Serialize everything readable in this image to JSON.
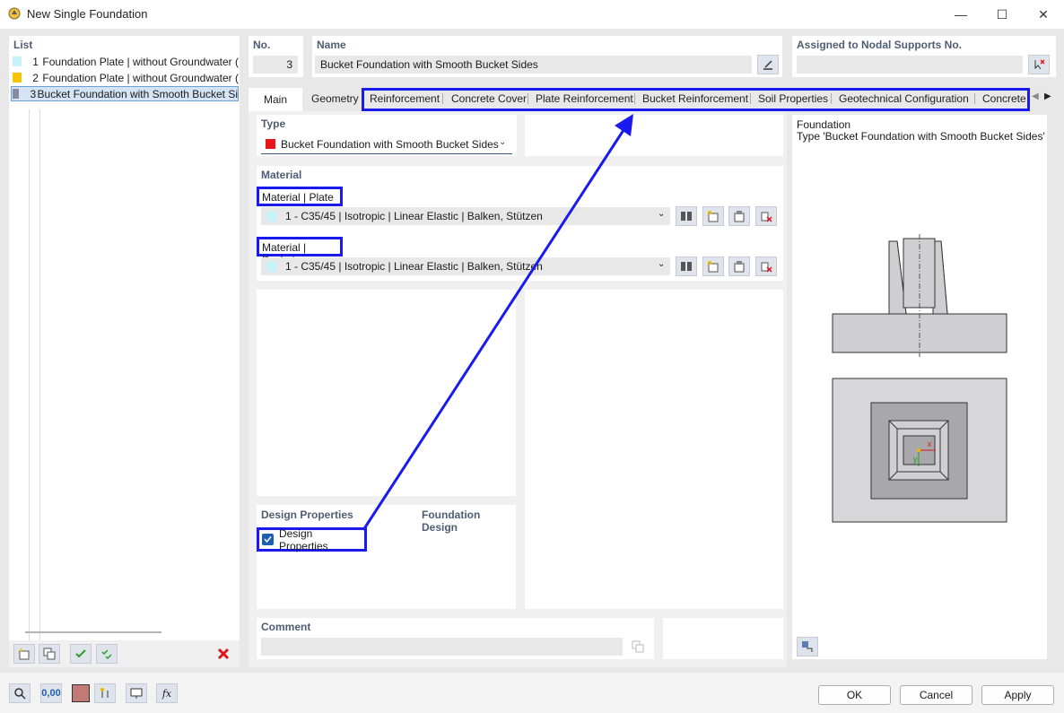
{
  "window": {
    "title": "New Single Foundation",
    "minimize": "—",
    "maximize": "☐",
    "close": "✕"
  },
  "list": {
    "header": "List",
    "items": [
      {
        "num": "1",
        "label": "Foundation Plate | without Groundwater (",
        "color": "#c5f3f9"
      },
      {
        "num": "2",
        "label": "Foundation Plate | without Groundwater (",
        "color": "#f7c400"
      },
      {
        "num": "3",
        "label": "Bucket Foundation with Smooth Bucket Si",
        "color": "#8a8aa4"
      }
    ]
  },
  "no": {
    "label": "No.",
    "value": "3"
  },
  "name": {
    "label": "Name",
    "value": "Bucket Foundation with Smooth Bucket Sides"
  },
  "assigned": {
    "label": "Assigned to Nodal Supports No.",
    "value": ""
  },
  "tabs": [
    "Main",
    "Geometry",
    "Reinforcement",
    "Concrete Cover",
    "Plate Reinforcement",
    "Bucket Reinforcement",
    "Soil Properties",
    "Geotechnical Configuration",
    "Concrete"
  ],
  "type": {
    "label": "Type",
    "value": "Bucket Foundation with Smooth Bucket Sides",
    "color": "#e8141c"
  },
  "material": {
    "section": "Material",
    "plate_label": "Material | Plate",
    "plate_value": "1 - C35/45 | Isotropic | Linear Elastic | Balken, Stützen",
    "bucket_label": "Material | Bucket",
    "bucket_value": "1 - C35/45 | Isotropic | Linear Elastic | Balken, Stützen",
    "swatch": "#c5f3f9"
  },
  "design": {
    "section": "Design Properties",
    "right": "Foundation Design",
    "checkbox_label": "Design Properties",
    "checked": true
  },
  "comment": {
    "label": "Comment",
    "value": ""
  },
  "preview": {
    "line1": "Foundation",
    "line2": "Type 'Bucket Foundation with Smooth Bucket Sides'",
    "axis_x": "x",
    "axis_y": "y"
  },
  "footer": {
    "ok": "OK",
    "cancel": "Cancel",
    "apply": "Apply",
    "value_icon": "0,00",
    "fx_icon": "fx",
    "swatch": "#c27a76"
  },
  "colors": {
    "highlight": "#1a1aee",
    "section_text": "#4e5d74"
  }
}
